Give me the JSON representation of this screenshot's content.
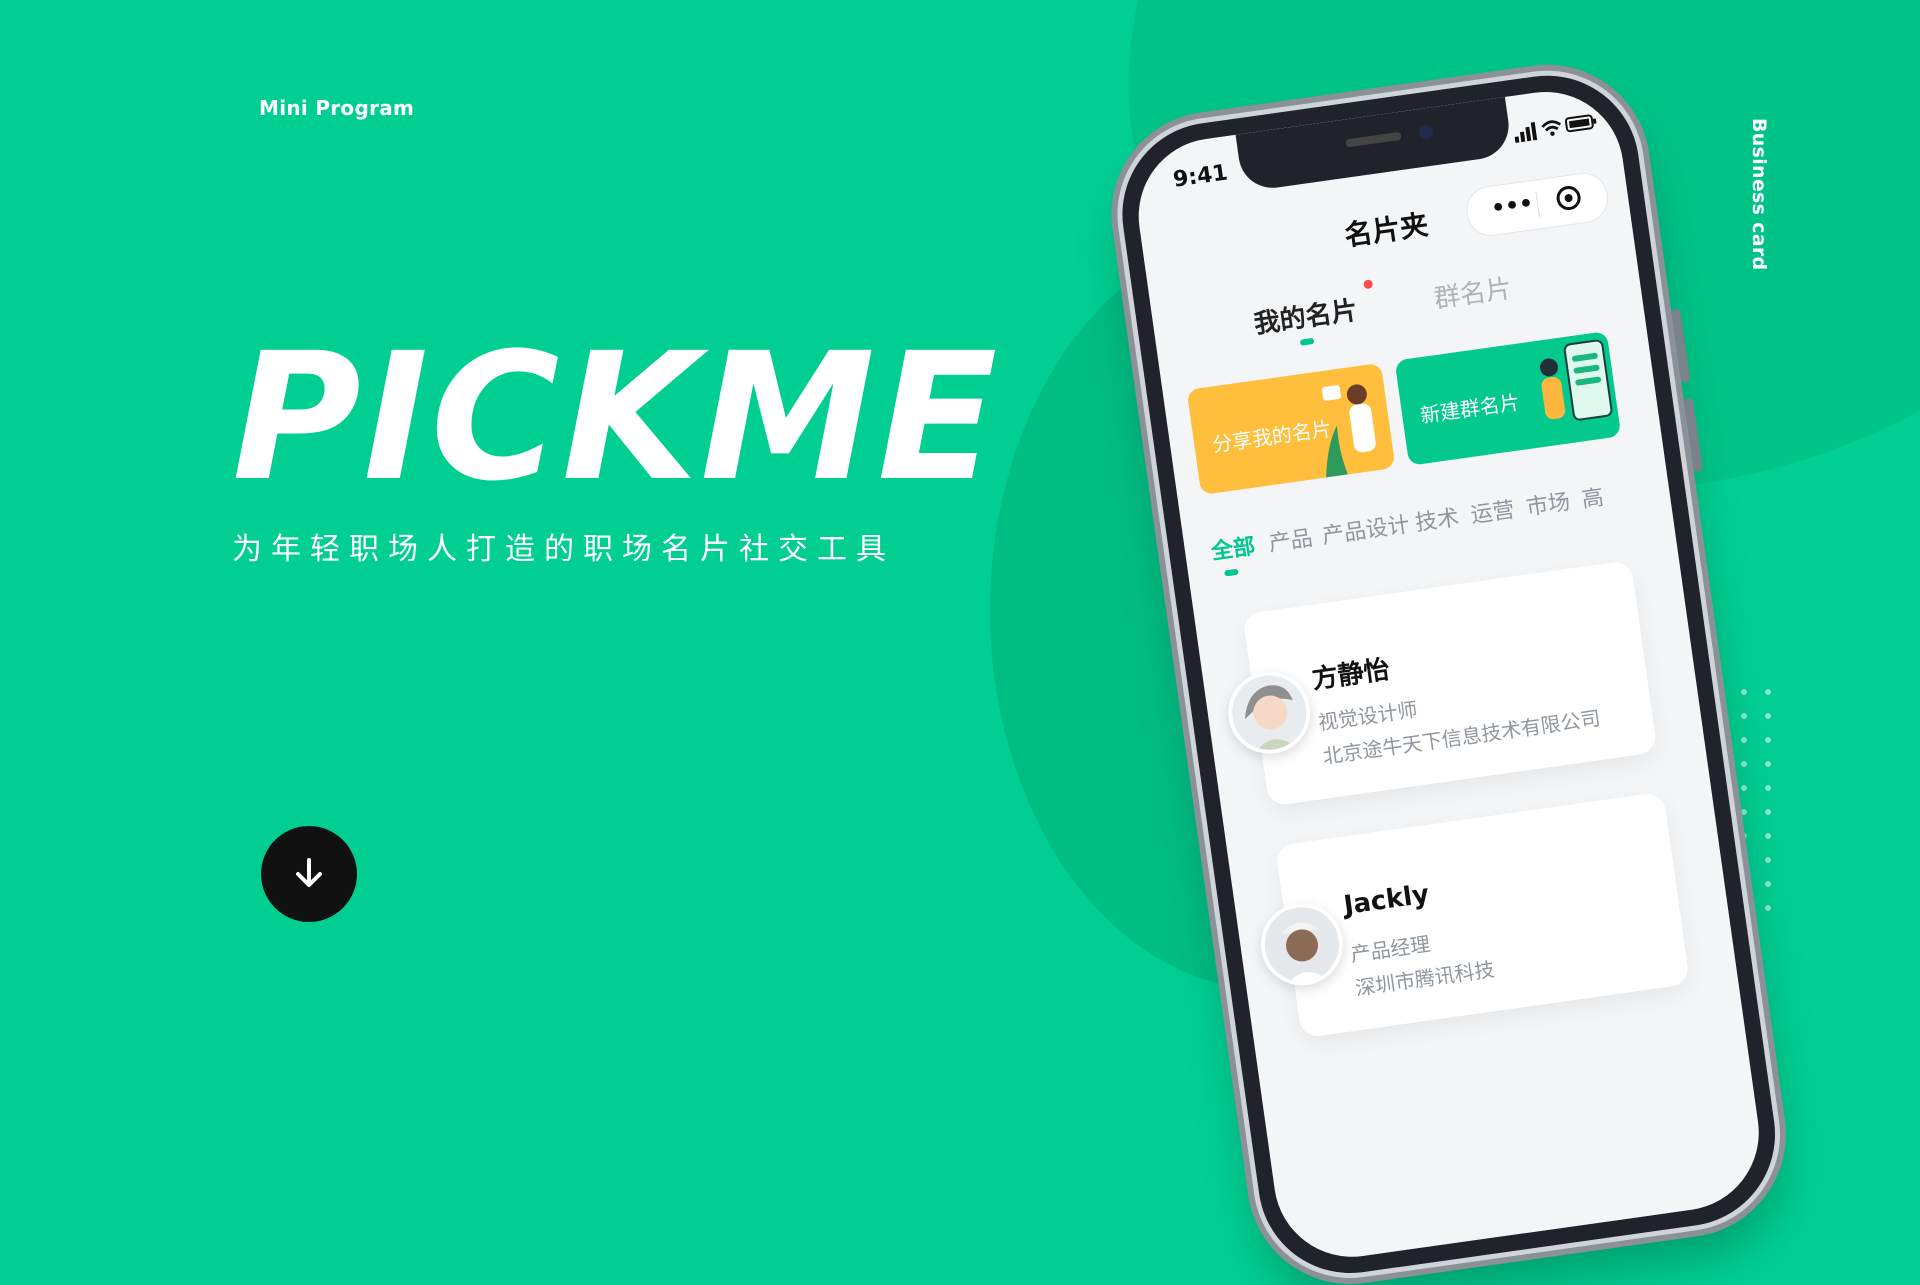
{
  "hero": {
    "tag": "Mini Program",
    "vertical_label": "Business card",
    "brand": "PICKME",
    "tagline": "为年轻职场人打造的职场名片社交工具"
  },
  "phone": {
    "status_time": "9:41",
    "title": "名片夹",
    "capsule_menu": "•••",
    "segments": [
      {
        "label": "我的名片",
        "active": true
      },
      {
        "label": "群名片",
        "active": false
      }
    ],
    "cards": [
      {
        "label": "分享我的名片",
        "color": "#ffbe3c"
      },
      {
        "label": "新建群名片",
        "color": "#03c98d"
      }
    ],
    "tabs": [
      "全部",
      "产品",
      "产品设计",
      "技术",
      "运营",
      "市场",
      "高"
    ],
    "contacts": [
      {
        "name": "方静怡",
        "role": "视觉设计师",
        "company": "北京途牛天下信息技术有限公司"
      },
      {
        "name": "Jackly",
        "role": "产品经理",
        "company": "深圳市腾讯科技"
      }
    ]
  },
  "icons": [
    "down-arrow-icon",
    "signal-icon",
    "wifi-icon",
    "battery-icon",
    "menu-dots-icon",
    "close-target-icon"
  ],
  "colors": {
    "background": "#00cf91",
    "accent": "#00c790",
    "yellow": "#ffbe3c",
    "dark": "#111111"
  }
}
